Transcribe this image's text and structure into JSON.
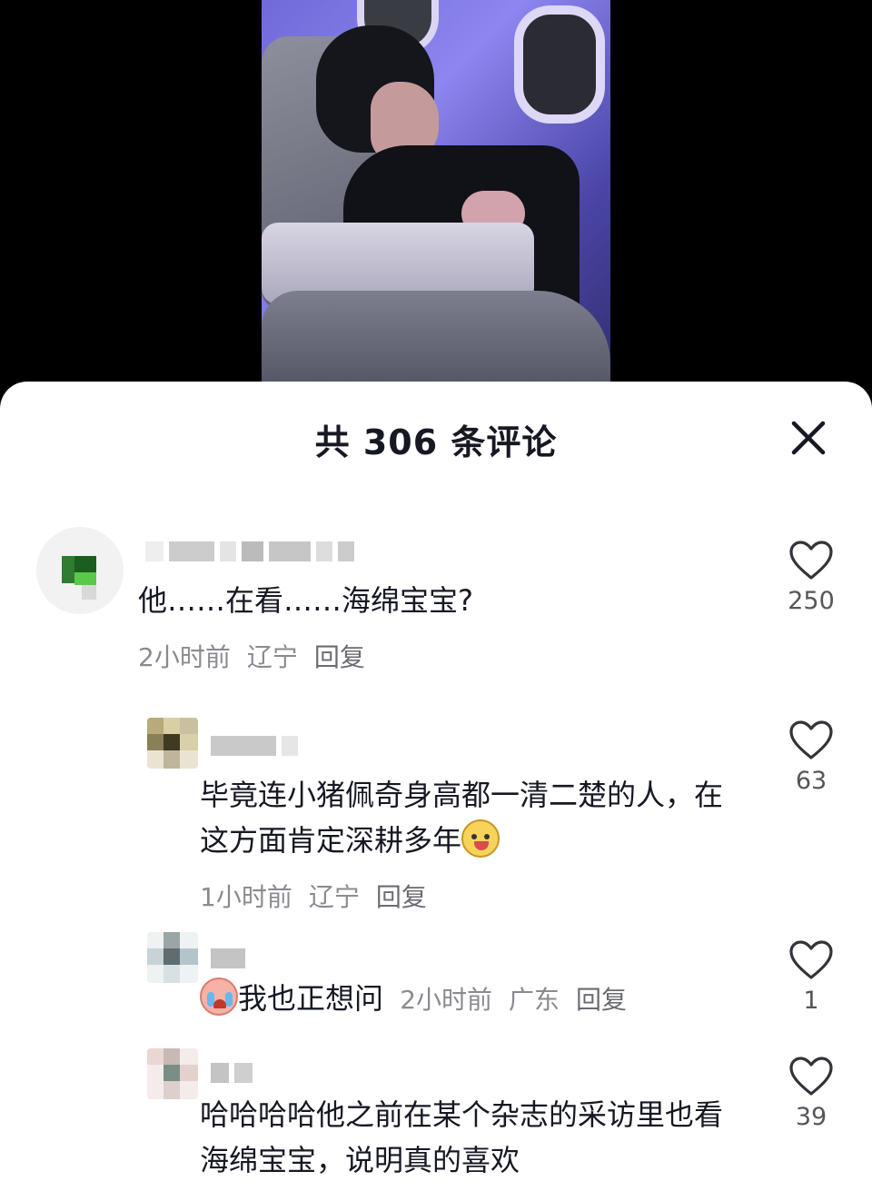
{
  "header": {
    "title": "共 306 条评论"
  },
  "comments": [
    {
      "text": "他……在看……海绵宝宝?",
      "time": "2小时前",
      "location": "辽宁",
      "reply_label": "回复",
      "likes": "250"
    },
    {
      "text": "毕竟连小猪佩奇身高都一清二楚的人，在这方面肯定深耕多年",
      "emoji": "dog-face-emoji",
      "time": "1小时前",
      "location": "辽宁",
      "reply_label": "回复",
      "likes": "63"
    },
    {
      "emoji": "crying-face-emoji",
      "text": "我也正想问",
      "time": "2小时前",
      "location": "广东",
      "reply_label": "回复",
      "likes": "1"
    },
    {
      "text": "哈哈哈哈他之前在某个杂志的采访里也看海绵宝宝，说明真的喜欢",
      "likes": "39"
    }
  ],
  "icons": {
    "close": "close-icon",
    "like": "heart-outline-icon"
  },
  "colors": {
    "sheet_bg": "#ffffff",
    "text_primary": "#161823",
    "text_secondary": "#8a8b91"
  }
}
